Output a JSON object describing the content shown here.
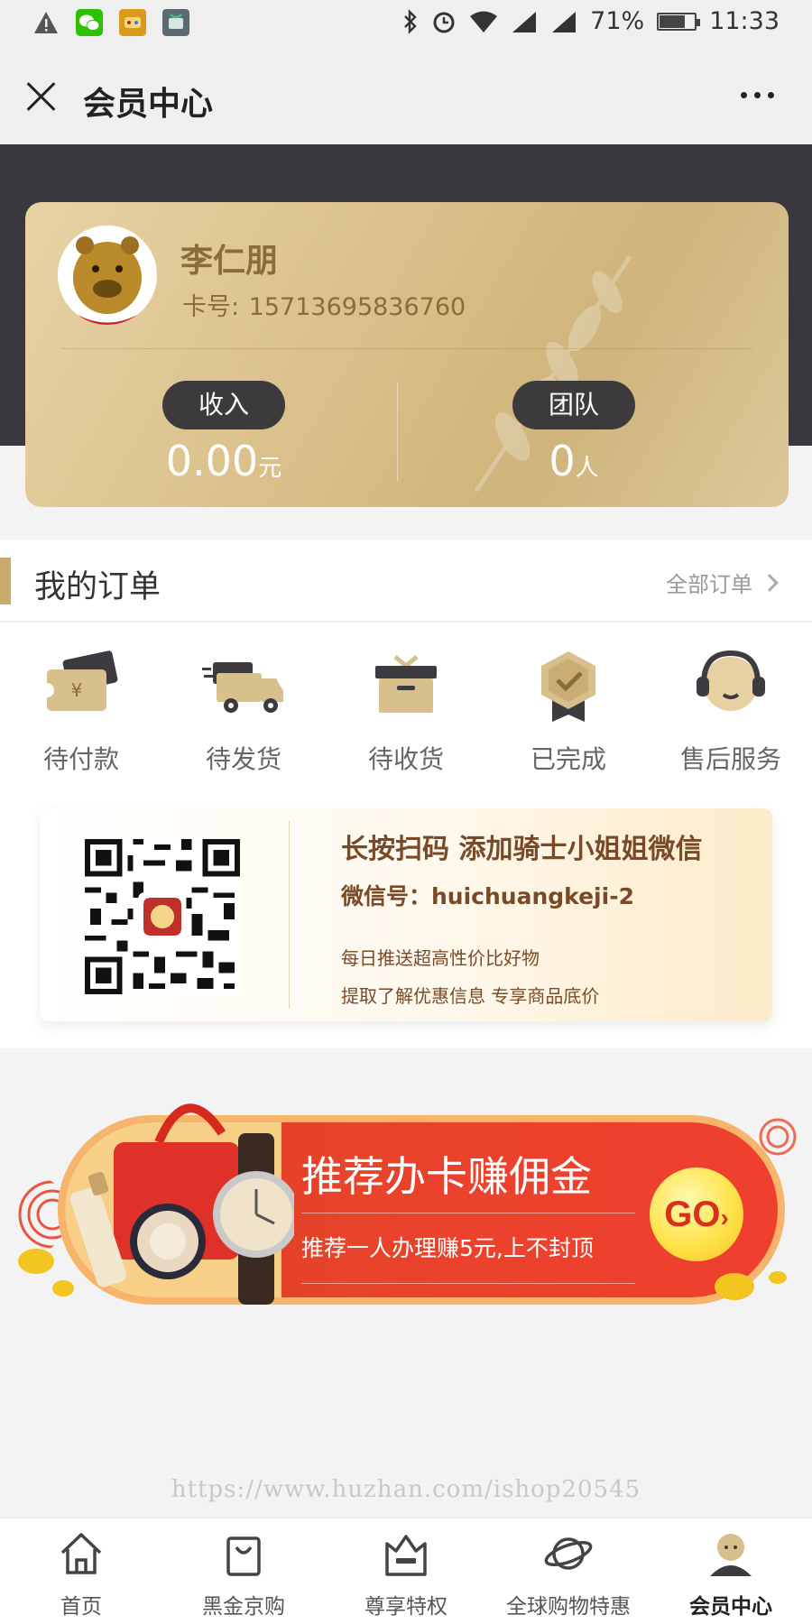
{
  "status_bar": {
    "battery": "71%",
    "time": "11:33"
  },
  "title_bar": {
    "title": "会员中心"
  },
  "member_card": {
    "name": "李仁朋",
    "card_label": "卡号:",
    "card_number": "15713695836760",
    "income_label": "收入",
    "income_value": "0.00",
    "income_unit": "元",
    "team_label": "团队",
    "team_value": "0",
    "team_unit": "人"
  },
  "orders": {
    "title": "我的订单",
    "all_orders": "全部订单",
    "items": [
      {
        "label": "待付款",
        "icon": "wallet-ticket-icon"
      },
      {
        "label": "待发货",
        "icon": "truck-icon"
      },
      {
        "label": "待收货",
        "icon": "box-icon"
      },
      {
        "label": "已完成",
        "icon": "badge-check-icon"
      },
      {
        "label": "售后服务",
        "icon": "headset-icon"
      }
    ]
  },
  "wechat_banner": {
    "title": "长按扫码   添加骑士小姐姐微信",
    "id_line": "微信号：huichuangkeji-2",
    "line1": "每日推送超高性价比好物",
    "line2": "提取了解优惠信息  专享商品底价"
  },
  "promo_banner": {
    "title": "推荐办卡赚佣金",
    "subtitle": "推荐一人办理赚5元,上不封顶",
    "go_label": "GO",
    "go_arrow": "›"
  },
  "watermark": "https://www.huzhan.com/ishop20545",
  "tab_bar": {
    "tabs": [
      {
        "label": "首页",
        "icon": "home-icon"
      },
      {
        "label": "黑金京购",
        "icon": "shopping-bag-icon"
      },
      {
        "label": "尊享特权",
        "icon": "crown-icon"
      },
      {
        "label": "全球购物特惠",
        "icon": "planet-icon"
      },
      {
        "label": "会员中心",
        "icon": "person-icon",
        "active": true
      }
    ]
  },
  "colors": {
    "gold": "#c9a96c",
    "dark_band": "#3a383f",
    "promo_red": "#e8432b",
    "brown_text": "#7a4a28"
  }
}
